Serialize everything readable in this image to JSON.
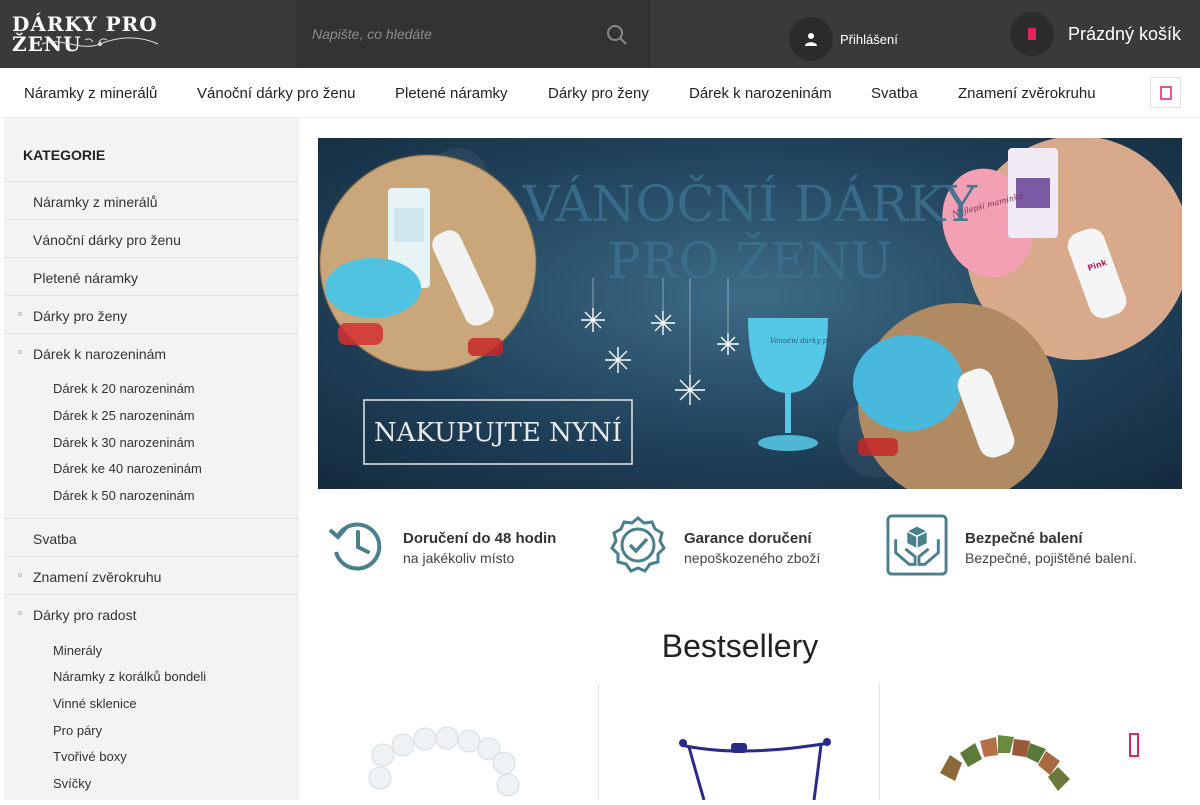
{
  "header": {
    "logo_text": "DÁRKY PRO ŽENU",
    "search_placeholder": "Napište, co hledáte",
    "login_label": "Přihlášení",
    "cart_label": "Prázdný košík"
  },
  "topnav": {
    "items": [
      "Náramky z minerálů",
      "Vánoční dárky pro ženu",
      "Pletené náramky",
      "Dárky pro ženy",
      "Dárek k narozeninám",
      "Svatba",
      "Znamení zvěrokruhu"
    ]
  },
  "sidebar": {
    "title": "KATEGORIE",
    "items": [
      "Náramky z minerálů",
      "Vánoční dárky pro ženu",
      "Pletené náramky",
      "Dárky pro ženy",
      "Dárek k narozeninám",
      "Svatba",
      "Znamení zvěrokruhu",
      "Dárky pro radost"
    ],
    "birthday_sub": [
      "Dárek k 20 narozeninám",
      "Dárek k 25 narozeninám",
      "Dárek k 30 narozeninám",
      "Dárek ke 40 narozeninám",
      "Dárek k 50 narozeninám"
    ],
    "joy_sub": [
      "Minerály",
      "Náramky z korálků bondeli",
      "Vinné sklenice",
      "Pro páry",
      "Tvořivé boxy",
      "Svíčky"
    ]
  },
  "banner": {
    "line1": "VÁNOČNÍ DÁRKY",
    "line2": "PRO ŽENU",
    "cta": "NAKUPUJTE NYNÍ",
    "glass_text": "Vánoční dárky pro ženu",
    "glass_text_right": "Nejlepší maminka",
    "box_label_right": "Pink"
  },
  "features": [
    {
      "title": "Doručení do 48 hodin",
      "sub": "na jakékoliv místo",
      "icon": "clock-history-icon"
    },
    {
      "title": "Garance doručení",
      "sub": "nepoškozeného zboží",
      "icon": "badge-check-icon"
    },
    {
      "title": "Bezpečné balení",
      "sub": "Bezpečné, pojištěné balení.",
      "icon": "box-hands-icon"
    }
  ],
  "bestsellers": {
    "title": "Bestsellery"
  },
  "colors": {
    "header_bg": "#3a3a3a",
    "accent": "#e0245e",
    "feature_icon": "#4a7f8c",
    "sidebar_bg": "#f3f3f3"
  }
}
